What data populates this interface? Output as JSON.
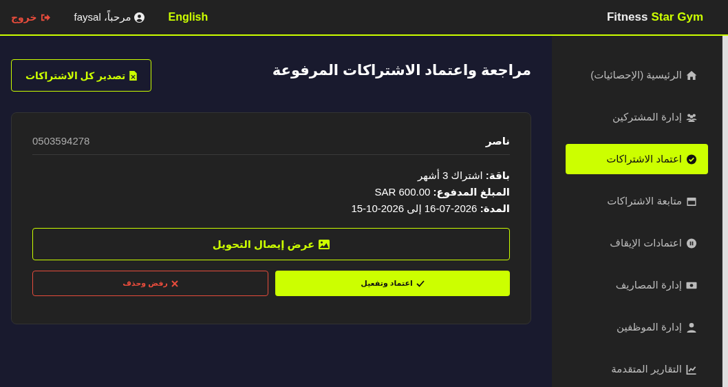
{
  "header": {
    "brand": {
      "first": "Fitness",
      "second": "Star Gym"
    },
    "language": "English",
    "greeting": "مرحباً، faysal",
    "logout": "خروج"
  },
  "sidebar": {
    "items": [
      {
        "label": "الرئيسية (الإحصائيات)",
        "selected": false
      },
      {
        "label": "إدارة المشتركين",
        "selected": false
      },
      {
        "label": "اعتماد الاشتراكات",
        "selected": true
      },
      {
        "label": "متابعة الاشتراكات",
        "selected": false
      },
      {
        "label": "اعتمادات الإيقاف",
        "selected": false
      },
      {
        "label": "إدارة المصاريف",
        "selected": false
      },
      {
        "label": "إدارة الموظفين",
        "selected": false
      },
      {
        "label": "التقارير المتقدمة",
        "selected": false
      }
    ]
  },
  "page": {
    "title": "مراجعة واعتماد الاشتراكات المرفوعة",
    "export_button": "تصدير كل الاشتراكات"
  },
  "requests": [
    {
      "name": "ناصر",
      "phone": "0503594278",
      "details": [
        "**باقة:** اشتراك 3 أشهر",
        "**المبلغ المدفوع:** SAR 600.00",
        "**المدة:** 2026-07-16 إلى 2026-10-15"
      ],
      "receipt_button": "عرض إيصال التحويل",
      "approve_button": "اعتماد وتفعيل",
      "reject_button": "رفض وحذف"
    }
  ]
}
